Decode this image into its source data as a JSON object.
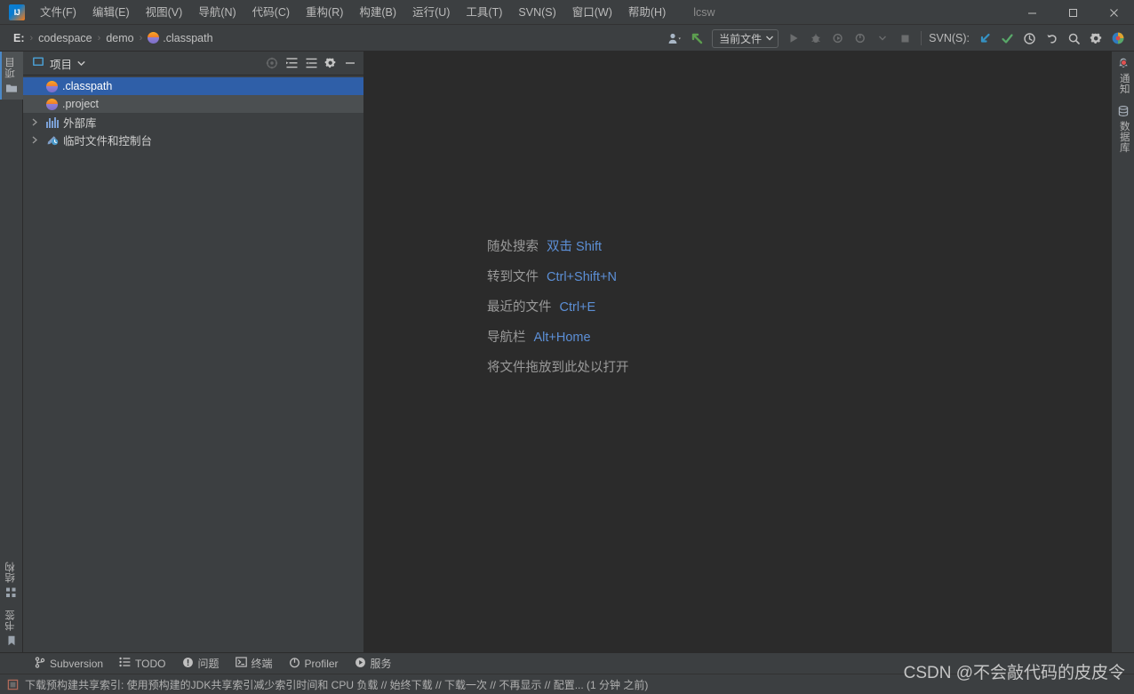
{
  "window": {
    "title": "lcsw",
    "controls": {
      "minimize": "minimize-icon",
      "maximize": "maximize-icon",
      "close": "close-icon"
    }
  },
  "menubar": {
    "logo": "intellij-idea-logo",
    "items": [
      {
        "label": "文件(F)"
      },
      {
        "label": "编辑(E)"
      },
      {
        "label": "视图(V)"
      },
      {
        "label": "导航(N)"
      },
      {
        "label": "代码(C)"
      },
      {
        "label": "重构(R)"
      },
      {
        "label": "构建(B)"
      },
      {
        "label": "运行(U)"
      },
      {
        "label": "工具(T)"
      },
      {
        "label": "SVN(S)"
      },
      {
        "label": "窗口(W)"
      },
      {
        "label": "帮助(H)"
      }
    ]
  },
  "toolbar": {
    "breadcrumb": {
      "drive": "E:",
      "separator": "›",
      "items": [
        {
          "label": "codespace",
          "icon": null
        },
        {
          "label": "demo",
          "icon": null
        },
        {
          "label": ".classpath",
          "icon": "xml-file-icon"
        }
      ]
    },
    "right": {
      "user_icon": "user-settings-icon",
      "updates_icon": "update-project-icon",
      "run_config": {
        "label": "当前文件",
        "chevron": "chevron-down-icon"
      },
      "run_icon": "run-icon",
      "debug_icon": "debug-icon",
      "coverage_icon": "run-with-coverage-icon",
      "profile_icon": "profile-icon",
      "profile_chevron": "chevron-down-icon",
      "stop_icon": "stop-icon",
      "svn_label": "SVN(S):",
      "svn_update_icon": "svn-update-icon",
      "svn_commit_icon": "svn-commit-icon",
      "history_icon": "history-clock-icon",
      "rollback_icon": "rollback-icon",
      "search_icon": "search-everywhere-icon",
      "settings_icon": "gear-icon",
      "account_icon": "account-globe-icon"
    }
  },
  "left_stripe": {
    "top": [
      {
        "label": "项目",
        "icon": "project-panel-icon",
        "active": true
      }
    ],
    "bottom": [
      {
        "label": "结构",
        "icon": "structure-icon",
        "active": false
      },
      {
        "label": "书签",
        "icon": "bookmarks-icon",
        "active": false
      }
    ]
  },
  "right_stripe": {
    "top": [
      {
        "label": "通知",
        "icon": "notifications-bell-icon",
        "badge": true
      },
      {
        "label": "数据库",
        "icon": "database-icon",
        "badge": false
      }
    ]
  },
  "project_panel": {
    "header": {
      "icon": "project-view-icon",
      "title": "项目",
      "chevron": "chevron-down-icon",
      "actions": [
        {
          "name": "select-opened-file-icon",
          "dim": true
        },
        {
          "name": "expand-all-icon",
          "dim": false
        },
        {
          "name": "collapse-all-icon",
          "dim": false
        },
        {
          "name": "gear-icon",
          "dim": false
        },
        {
          "name": "hide-panel-icon",
          "dim": false
        }
      ]
    },
    "tree": [
      {
        "label": ".classpath",
        "icon": "xml-file-icon",
        "state": "selected",
        "twisty": false
      },
      {
        "label": ".project",
        "icon": "xml-file-icon",
        "state": "hovered",
        "twisty": false
      },
      {
        "label": "外部库",
        "icon": "external-libraries-icon",
        "state": "normal",
        "twisty": true
      },
      {
        "label": "临时文件和控制台",
        "icon": "scratches-consoles-icon",
        "state": "normal",
        "twisty": true
      }
    ]
  },
  "editor": {
    "hints": [
      {
        "label": "随处搜索",
        "key": "双击 Shift"
      },
      {
        "label": "转到文件",
        "key": "Ctrl+Shift+N"
      },
      {
        "label": "最近的文件",
        "key": "Ctrl+E"
      },
      {
        "label": "导航栏",
        "key": "Alt+Home"
      }
    ],
    "drop_hint": "将文件拖放到此处以打开"
  },
  "bottom_toolwindows": [
    {
      "label": "Subversion",
      "icon": "subversion-branch-icon"
    },
    {
      "label": "TODO",
      "icon": "todo-list-icon"
    },
    {
      "label": "问题",
      "icon": "problems-icon"
    },
    {
      "label": "终端",
      "icon": "terminal-icon"
    },
    {
      "label": "Profiler",
      "icon": "profiler-icon"
    },
    {
      "label": "服务",
      "icon": "services-icon"
    }
  ],
  "statusbar": {
    "icon": "event-log-icon",
    "message": "下载预构建共享索引: 使用预构建的JDK共享索引减少索引时间和 CPU 负载 // 始终下载 // 下载一次 // 不再显示 // 配置... (1 分钟 之前)"
  },
  "watermark": "CSDN @不会敲代码的皮皮令",
  "colors": {
    "window_bg": "#3c3f41",
    "editor_bg": "#2b2b2b",
    "selection_blue": "#2f5fa8",
    "hint_key_blue": "#5c8fd6",
    "text_primary": "#bbbbbb",
    "accent_green": "#59a869",
    "accent_blue": "#3592c4",
    "badge_red": "#e05252"
  }
}
